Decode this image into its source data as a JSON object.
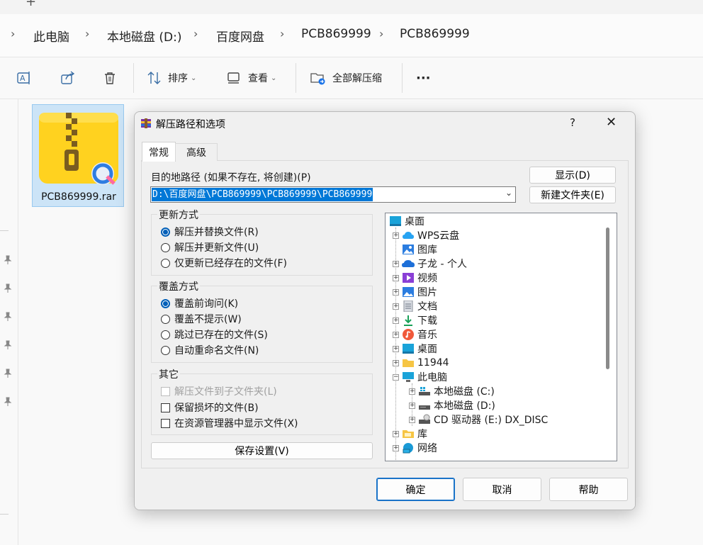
{
  "explorer": {
    "new_tab": "+",
    "breadcrumbs": [
      "此电脑",
      "本地磁盘 (D:)",
      "百度网盘",
      "PCB869999",
      "PCB869999"
    ],
    "toolbar": {
      "sort_label": "排序",
      "view_label": "查看",
      "extract_all_label": "全部解压缩",
      "more_label": "···"
    },
    "file": {
      "name": "PCB869999.rar"
    }
  },
  "dialog": {
    "title": "解压路径和选项",
    "help": "?",
    "close": "✕",
    "tabs": [
      "常规",
      "高级"
    ],
    "dest_label": "目的地路径 (如果不存在, 将创建)(P)",
    "dest_value": "D:\\百度网盘\\PCB869999\\PCB869999\\PCB869999",
    "show_button": "显示(D)",
    "new_folder_button": "新建文件夹(E)",
    "update_group": {
      "title": "更新方式",
      "options": [
        "解压并替换文件(R)",
        "解压并更新文件(U)",
        "仅更新已经存在的文件(F)"
      ],
      "selected": 0
    },
    "overwrite_group": {
      "title": "覆盖方式",
      "options": [
        "覆盖前询问(K)",
        "覆盖不提示(W)",
        "跳过已存在的文件(S)",
        "自动重命名文件(N)"
      ],
      "selected": 0
    },
    "misc_group": {
      "title": "其它",
      "options": [
        "解压文件到子文件夹(L)",
        "保留损坏的文件(B)",
        "在资源管理器中显示文件(X)"
      ]
    },
    "save_button": "保存设置(V)",
    "tree": {
      "root": "桌面",
      "items": [
        "WPS云盘",
        "图库",
        "子龙 - 个人",
        "视频",
        "图片",
        "文档",
        "下载",
        "音乐",
        "桌面",
        "11944",
        "此电脑"
      ],
      "pc_children": [
        "本地磁盘 (C:)",
        "本地磁盘 (D:)",
        "CD 驱动器 (E:) DX_DISC"
      ],
      "after": [
        "库",
        "网络"
      ]
    },
    "ok_button": "确定",
    "cancel_button": "取消",
    "help_button": "帮助"
  }
}
